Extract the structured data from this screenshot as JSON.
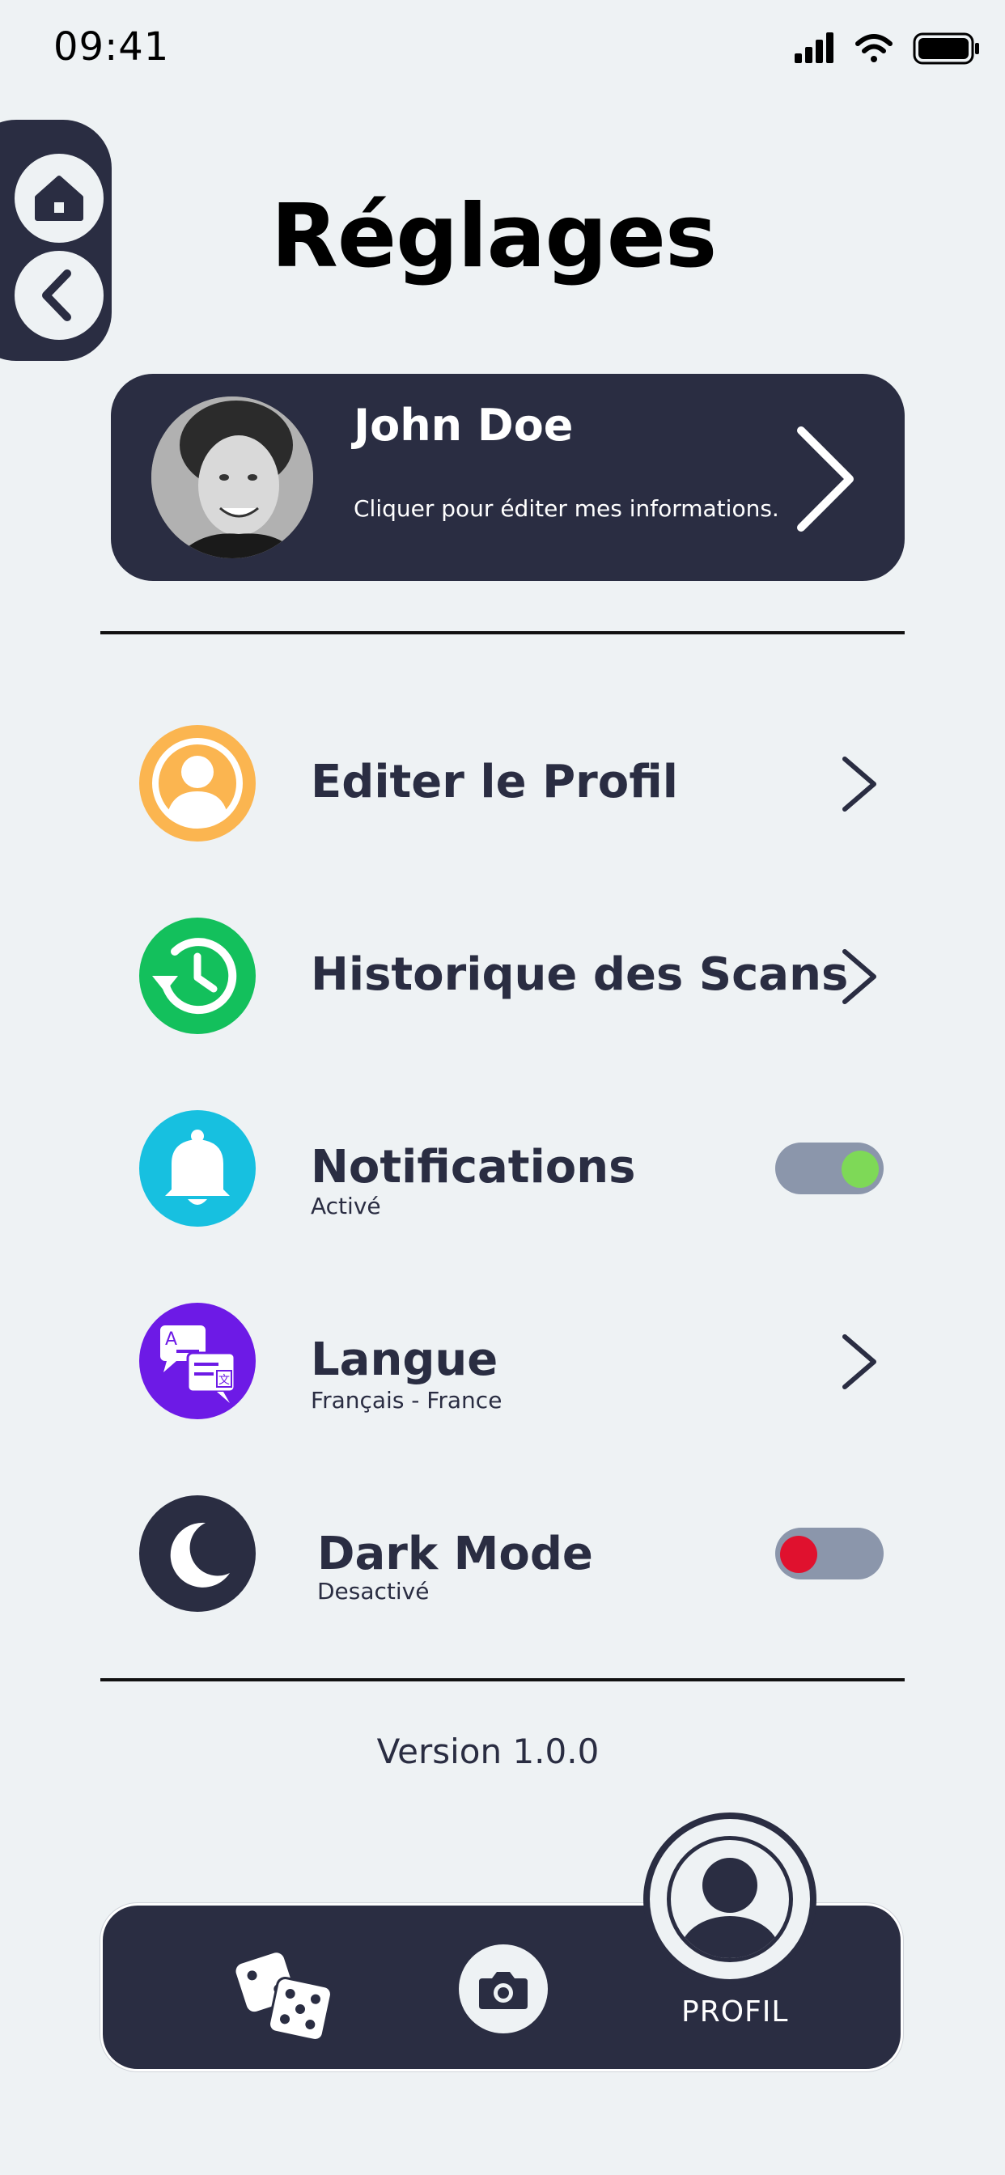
{
  "status_bar": {
    "time": "09:41"
  },
  "page": {
    "title": "Réglages"
  },
  "profile_card": {
    "name": "John Doe",
    "subtitle": "Cliquer pour éditer mes informations."
  },
  "settings": [
    {
      "label": "Editer le Profil",
      "icon": "user-circle-icon",
      "color": "#fbb550",
      "control": "chevron"
    },
    {
      "label": "Historique des Scans",
      "icon": "history-clock-icon",
      "color": "#13c05c",
      "control": "chevron"
    },
    {
      "label": "Notifications",
      "sub": "Activé",
      "icon": "bell-icon",
      "color": "#17c0e0",
      "control": "toggle",
      "toggle_on": true,
      "knob_color": "#7ed957"
    },
    {
      "label": "Langue",
      "sub": "Français - France",
      "icon": "translate-icon",
      "color": "#6d1ae6",
      "control": "chevron"
    },
    {
      "label": "Dark Mode",
      "sub": "Desactivé",
      "icon": "moon-icon",
      "color": "#2a2d42",
      "control": "toggle",
      "toggle_on": false,
      "knob_color": "#e0112e"
    }
  ],
  "version": "Version 1.0.0",
  "tab_bar": {
    "profile_label": "PROFIL"
  },
  "colors": {
    "background": "#eef2f4",
    "primary": "#2a2d42"
  }
}
